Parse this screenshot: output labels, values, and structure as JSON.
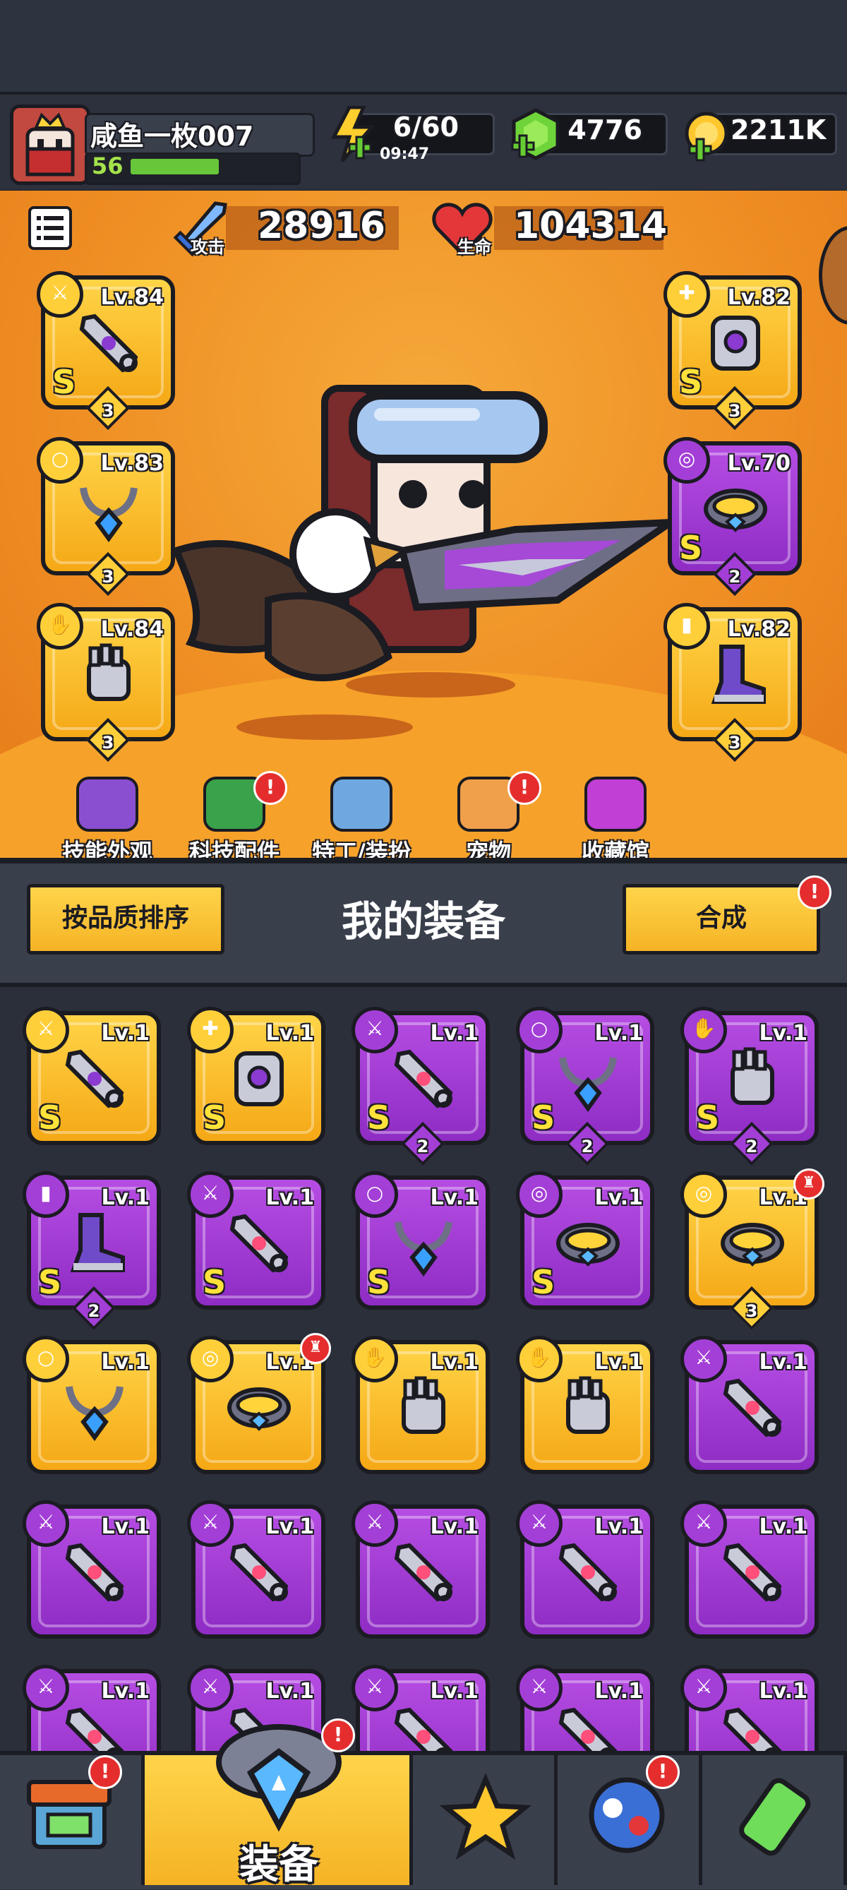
{
  "player": {
    "name": "咸鱼一枚007",
    "level": "56",
    "xp_fraction": 0.5
  },
  "resources": {
    "energy": {
      "value": "6/60",
      "timer": "09:47"
    },
    "gems": "4776",
    "coins": "2211K"
  },
  "stats": {
    "attack_label": "攻击",
    "attack_value": "28916",
    "hp_label": "生命",
    "hp_value": "104314"
  },
  "equipped": [
    {
      "slot": "weapon",
      "level": "Lv.84",
      "grade": "S",
      "stars": "3",
      "rarity": "gold"
    },
    {
      "slot": "necklace",
      "level": "Lv.83",
      "grade": "",
      "stars": "3",
      "rarity": "gold"
    },
    {
      "slot": "gloves",
      "level": "Lv.84",
      "grade": "",
      "stars": "3",
      "rarity": "gold"
    },
    {
      "slot": "armor",
      "level": "Lv.82",
      "grade": "S",
      "stars": "3",
      "rarity": "gold"
    },
    {
      "slot": "belt",
      "level": "Lv.70",
      "grade": "S",
      "stars": "2",
      "rarity": "purple"
    },
    {
      "slot": "boots",
      "level": "Lv.82",
      "grade": "",
      "stars": "3",
      "rarity": "gold"
    }
  ],
  "menu": [
    {
      "label": "技能外观",
      "badge": false,
      "icon": "hat-icon"
    },
    {
      "label": "科技配件",
      "badge": true,
      "icon": "chip-icon"
    },
    {
      "label": "特工/装扮",
      "badge": false,
      "icon": "agent-icon"
    },
    {
      "label": "宠物",
      "badge": true,
      "icon": "dog-icon"
    },
    {
      "label": "收藏馆",
      "badge": false,
      "icon": "chest-icon"
    }
  ],
  "inventory_header": {
    "sort_label": "按品质排序",
    "title": "我的装备",
    "merge_label": "合成",
    "merge_badge": "!"
  },
  "inventory": [
    {
      "level": "Lv.1",
      "grade": "S",
      "stars": "",
      "rarity": "gold",
      "type": "weapon",
      "badge": false
    },
    {
      "level": "Lv.1",
      "grade": "S",
      "stars": "",
      "rarity": "gold",
      "type": "armor",
      "badge": false
    },
    {
      "level": "Lv.1",
      "grade": "S",
      "stars": "2",
      "rarity": "purple",
      "type": "weapon",
      "badge": false
    },
    {
      "level": "Lv.1",
      "grade": "S",
      "stars": "2",
      "rarity": "purple",
      "type": "necklace",
      "badge": false
    },
    {
      "level": "Lv.1",
      "grade": "S",
      "stars": "2",
      "rarity": "purple",
      "type": "gloves",
      "badge": false
    },
    {
      "level": "Lv.1",
      "grade": "S",
      "stars": "2",
      "rarity": "purple",
      "type": "boots",
      "badge": false
    },
    {
      "level": "Lv.1",
      "grade": "S",
      "stars": "",
      "rarity": "purple",
      "type": "weapon",
      "badge": false
    },
    {
      "level": "Lv.1",
      "grade": "S",
      "stars": "",
      "rarity": "purple",
      "type": "necklace",
      "badge": false
    },
    {
      "level": "Lv.1",
      "grade": "S",
      "stars": "",
      "rarity": "purple",
      "type": "belt",
      "badge": false
    },
    {
      "level": "Lv.1",
      "grade": "",
      "stars": "3",
      "rarity": "gold",
      "type": "belt",
      "badge": true
    },
    {
      "level": "Lv.1",
      "grade": "",
      "stars": "",
      "rarity": "gold",
      "type": "necklace",
      "badge": false
    },
    {
      "level": "Lv.1",
      "grade": "",
      "stars": "",
      "rarity": "gold",
      "type": "belt",
      "badge": true
    },
    {
      "level": "Lv.1",
      "grade": "",
      "stars": "",
      "rarity": "gold",
      "type": "gloves",
      "badge": false
    },
    {
      "level": "Lv.1",
      "grade": "",
      "stars": "",
      "rarity": "gold",
      "type": "gloves",
      "badge": false
    },
    {
      "level": "Lv.1",
      "grade": "",
      "stars": "",
      "rarity": "purple",
      "type": "weapon",
      "badge": false
    },
    {
      "level": "Lv.1",
      "grade": "",
      "stars": "",
      "rarity": "purple",
      "type": "weapon",
      "badge": false
    },
    {
      "level": "Lv.1",
      "grade": "",
      "stars": "",
      "rarity": "purple",
      "type": "weapon",
      "badge": false
    },
    {
      "level": "Lv.1",
      "grade": "",
      "stars": "",
      "rarity": "purple",
      "type": "weapon",
      "badge": false
    },
    {
      "level": "Lv.1",
      "grade": "",
      "stars": "",
      "rarity": "purple",
      "type": "weapon",
      "badge": false
    },
    {
      "level": "Lv.1",
      "grade": "",
      "stars": "",
      "rarity": "purple",
      "type": "weapon",
      "badge": false
    },
    {
      "level": "Lv.1",
      "grade": "",
      "stars": "",
      "rarity": "purple",
      "type": "weapon",
      "badge": false
    },
    {
      "level": "Lv.1",
      "grade": "",
      "stars": "",
      "rarity": "purple",
      "type": "weapon",
      "badge": false
    },
    {
      "level": "Lv.1",
      "grade": "",
      "stars": "",
      "rarity": "purple",
      "type": "weapon",
      "badge": false
    },
    {
      "level": "Lv.1",
      "grade": "",
      "stars": "",
      "rarity": "purple",
      "type": "weapon",
      "badge": false
    },
    {
      "level": "Lv.1",
      "grade": "",
      "stars": "",
      "rarity": "purple",
      "type": "weapon",
      "badge": false
    }
  ],
  "bottom_nav": [
    {
      "name": "shop",
      "label": "",
      "badge": true
    },
    {
      "name": "equipment",
      "label": "装备",
      "badge": true,
      "active": true
    },
    {
      "name": "battle",
      "label": "",
      "badge": false
    },
    {
      "name": "stars",
      "label": "",
      "badge": true
    },
    {
      "name": "lab",
      "label": "",
      "badge": false
    }
  ],
  "colors": {
    "gold": "#ffcf3a",
    "purple": "#a33fd6",
    "orange_bg": "#ef8f24",
    "badge_red": "#e52d2d"
  }
}
